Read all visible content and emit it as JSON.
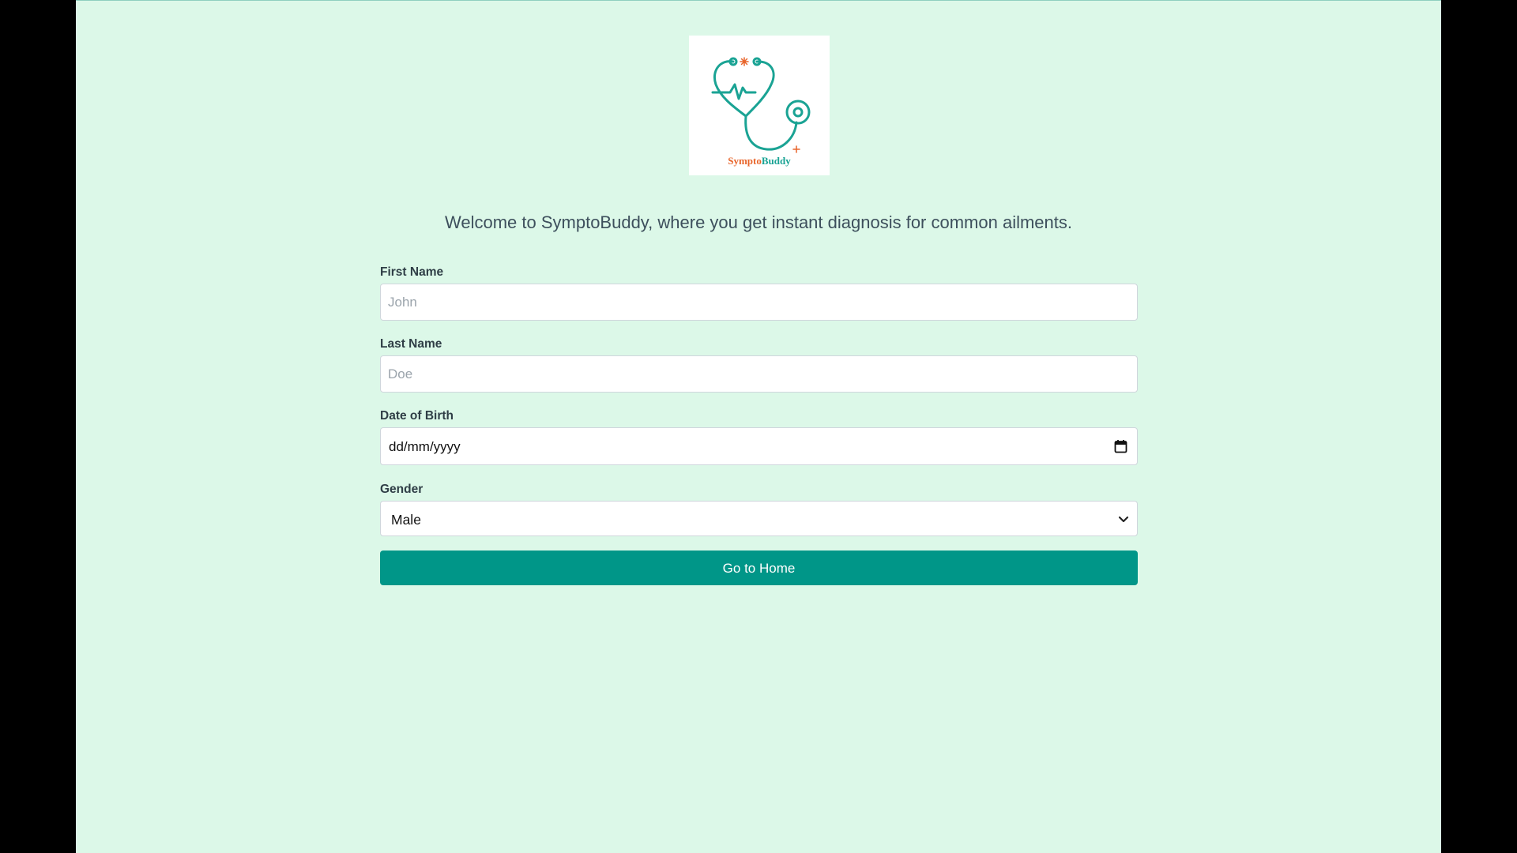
{
  "logo": {
    "icon": "stethoscope-heartbeat-logo",
    "text_part1": "Sympto",
    "text_part2": "Buddy",
    "colors": {
      "teal": "#1aa394",
      "orange": "#e8652b"
    }
  },
  "welcome_text": "Welcome to SymptoBuddy, where you get instant diagnosis for common ailments.",
  "form": {
    "first_name": {
      "label": "First Name",
      "placeholder": "John",
      "value": ""
    },
    "last_name": {
      "label": "Last Name",
      "placeholder": "Doe",
      "value": ""
    },
    "dob": {
      "label": "Date of Birth",
      "placeholder": "dd/mm/yyyy",
      "icon": "calendar-icon"
    },
    "gender": {
      "label": "Gender",
      "selected": "Male",
      "icon": "chevron-down-icon"
    },
    "submit_label": "Go to Home"
  },
  "colors": {
    "background": "#dcf8e8",
    "button": "#009688",
    "button_text": "#ffffff"
  }
}
